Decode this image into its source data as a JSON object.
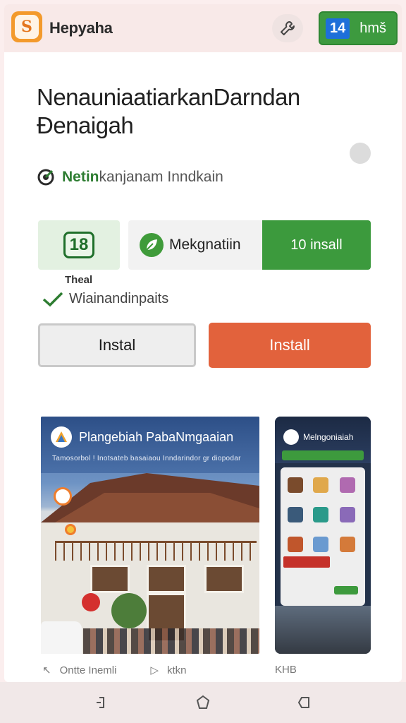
{
  "header": {
    "app_title": "Hepyaha",
    "badge_number": "14",
    "badge_label": "hmš"
  },
  "main": {
    "heading": "NenauniaatiarkanDarndan Ðenaigah",
    "subtitle_green": "Netin",
    "subtitle_rest": " kanjanam Inndkain",
    "rating_value": "18",
    "rating_label": "Theal",
    "developer": "Mekgnatiin",
    "installs": "10 insall",
    "verified_text": "Wiainandinpaits",
    "btn_secondary": "Instal",
    "btn_primary": "Install"
  },
  "screenshots": [
    {
      "title": "Plangebiah PabaNmgaaian",
      "subtitle": "Tamosorbol ! Inotsateb basaiaou Inndarindor gr diopodar",
      "caption_a": "Ontte Inemli",
      "caption_b": "ktkn"
    },
    {
      "title": "Melngoniaiah",
      "caption": "KHB"
    }
  ],
  "icons": [
    "app-logo-icon",
    "wrench-icon",
    "target-icon",
    "leaf-icon",
    "check-icon",
    "back-nav-icon",
    "home-nav-icon",
    "recents-nav-icon"
  ],
  "colors": {
    "accent_green": "#3c9a3d",
    "primary_orange": "#e2623c",
    "badge_blue": "#1e6fd9"
  }
}
